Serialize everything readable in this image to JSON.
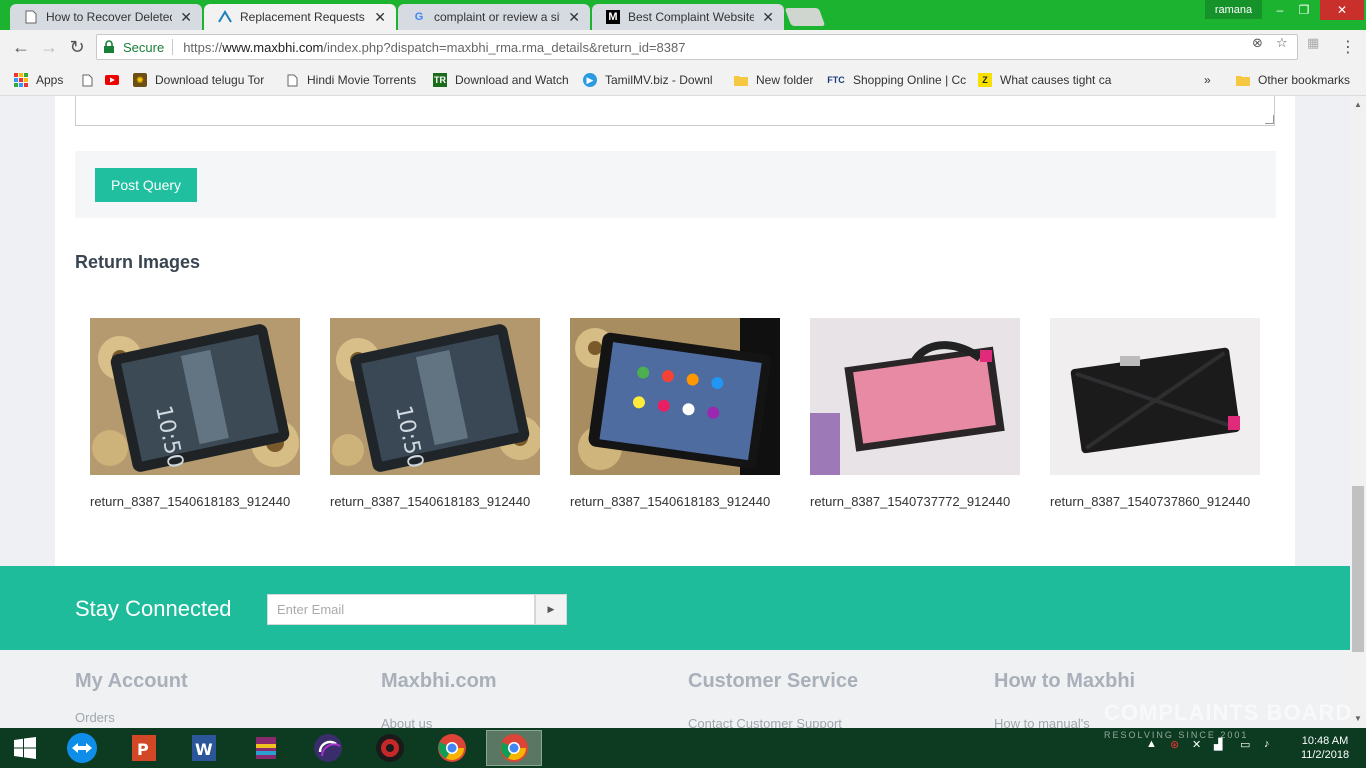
{
  "browser": {
    "tabs": [
      {
        "title": "How to Recover Deleted",
        "icon": "page-icon"
      },
      {
        "title": "Replacement Requests ::",
        "icon": "maxbhi-icon"
      },
      {
        "title": "complaint or review a site",
        "icon": "google-icon"
      },
      {
        "title": "Best Complaint Websites",
        "icon": "medium-icon"
      }
    ],
    "profile": "ramana",
    "secure_label": "Secure",
    "url_scheme": "https://",
    "url_host": "www.maxbhi.com",
    "url_path": "/index.php?dispatch=maxbhi_rma.rma_details&return_id=8387"
  },
  "bookmarks": [
    {
      "label": "Apps"
    },
    {
      "label": ""
    },
    {
      "label": ""
    },
    {
      "label": "Download telugu Tor"
    },
    {
      "label": "Hindi Movie Torrents"
    },
    {
      "label": "Download and Watch"
    },
    {
      "label": "TamilMV.biz - Downl"
    },
    {
      "label": "New folder"
    },
    {
      "label": "Shopping Online | Cc"
    },
    {
      "label": "What causes tight ca"
    },
    {
      "label": "»"
    },
    {
      "label": "Other bookmarks"
    }
  ],
  "page": {
    "post_button": "Post Query",
    "section_title": "Return Images",
    "images": [
      {
        "caption": "return_8387_1540618183_912440"
      },
      {
        "caption": "return_8387_1540618183_912440"
      },
      {
        "caption": "return_8387_1540618183_912440"
      },
      {
        "caption": "return_8387_1540737772_912440"
      },
      {
        "caption": "return_8387_1540737860_912440"
      }
    ],
    "stay_connected": "Stay Connected",
    "email_placeholder": "Enter Email",
    "footer": [
      {
        "title": "My Account",
        "link": "Orders"
      },
      {
        "title": "Maxbhi.com",
        "link": "About us"
      },
      {
        "title": "Customer Service",
        "link": "Contact Customer Support"
      },
      {
        "title": "How to Maxbhi",
        "link": "How to manual's"
      }
    ]
  },
  "taskbar": {
    "time": "10:48 AM",
    "date": "11/2/2018",
    "watermark_main": "COMPLAINTS BOARD",
    "watermark_sub": "RESOLVING SINCE 2001"
  },
  "colors": {
    "accent": "#1fbc9c",
    "button": "#1fbfa0",
    "chrome_frame": "#1bb32f"
  }
}
